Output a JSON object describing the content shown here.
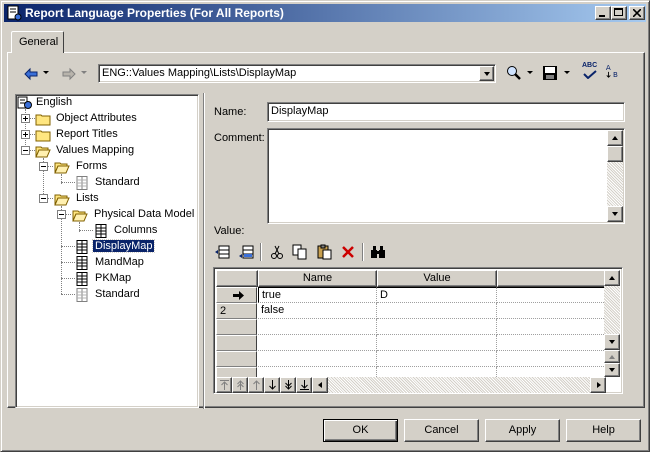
{
  "window": {
    "title": "Report Language Properties (For All Reports)"
  },
  "tabs": [
    {
      "label": "General"
    }
  ],
  "toolbar": {
    "path_value": "ENG::Values Mapping\\Lists\\DisplayMap",
    "spell_label": "ABC"
  },
  "tree": {
    "root": "English",
    "items": [
      {
        "label": "Object Attributes"
      },
      {
        "label": "Report Titles"
      },
      {
        "label": "Values Mapping"
      },
      {
        "label": "Forms"
      },
      {
        "label": "Standard"
      },
      {
        "label": "Lists"
      },
      {
        "label": "Physical Data Model"
      },
      {
        "label": "Columns"
      },
      {
        "label": "DisplayMap"
      },
      {
        "label": "MandMap"
      },
      {
        "label": "PKMap"
      },
      {
        "label": "Standard"
      }
    ]
  },
  "form": {
    "name_label": "Name:",
    "name_value": "DisplayMap",
    "comment_label": "Comment:",
    "comment_value": "",
    "value_label": "Value:"
  },
  "grid": {
    "columns": [
      "Name",
      "Value"
    ],
    "rows": [
      {
        "header": "",
        "name": "true",
        "value": "D"
      },
      {
        "header": "2",
        "name": "false",
        "value": ""
      }
    ]
  },
  "buttons": {
    "ok": "OK",
    "cancel": "Cancel",
    "apply": "Apply",
    "help": "Help"
  },
  "colors": {
    "titlebar_start": "#0a246a",
    "titlebar_end": "#a6caf0",
    "selection": "#0a246a",
    "face": "#d4d0c8",
    "delete_red": "#cc0000",
    "folder_yellow": "#ffe680"
  }
}
